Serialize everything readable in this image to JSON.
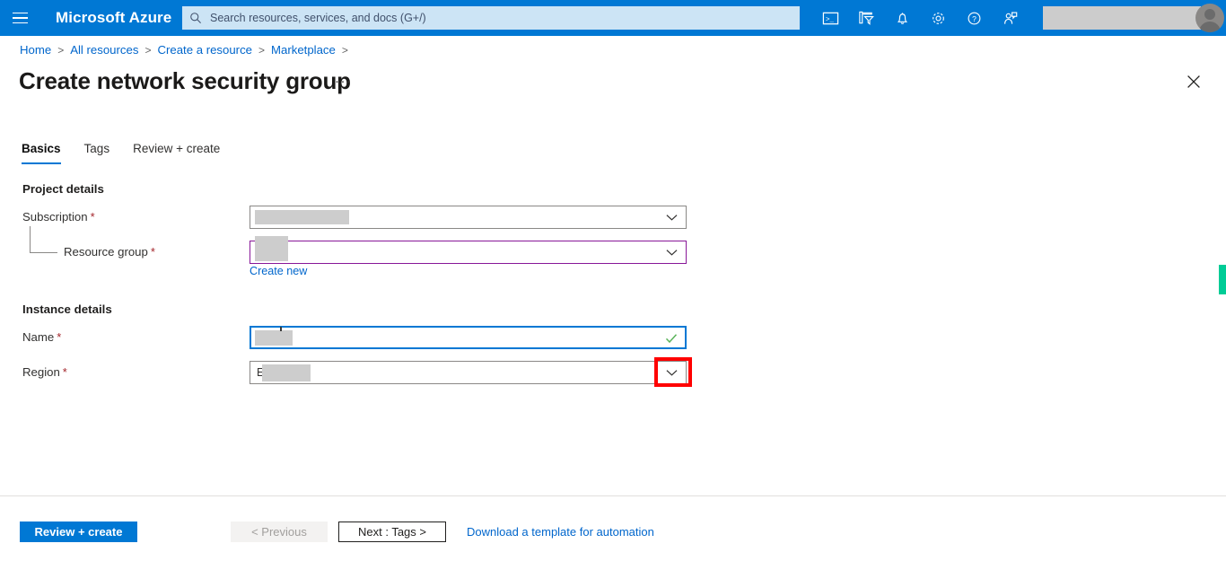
{
  "topbar": {
    "menu_icon": "hamburger-icon",
    "brand": "Microsoft Azure",
    "search_placeholder": "Search resources, services, and docs (G+/)",
    "search_value": "",
    "icons": [
      {
        "name": "cloud-shell-icon",
        "title": "Cloud Shell"
      },
      {
        "name": "directory-filter-icon",
        "title": "Directories + subscriptions"
      },
      {
        "name": "notifications-bell-icon",
        "title": "Notifications"
      },
      {
        "name": "settings-gear-icon",
        "title": "Settings"
      },
      {
        "name": "help-question-icon",
        "title": "Help"
      },
      {
        "name": "feedback-person-icon",
        "title": "Feedback"
      }
    ],
    "account_redacted": "",
    "avatar": "user-avatar"
  },
  "breadcrumb": {
    "items": [
      "Home",
      "All resources",
      "Create a resource",
      "Marketplace"
    ],
    "separator": ">",
    "trailing_separator": ">"
  },
  "page": {
    "title": "Create network security group",
    "more_actions": "···",
    "close": "✕"
  },
  "tabs": [
    {
      "label": "Basics",
      "active": true
    },
    {
      "label": "Tags",
      "active": false
    },
    {
      "label": "Review + create",
      "active": false
    }
  ],
  "form": {
    "project_details_header": "Project details",
    "instance_details_header": "Instance details",
    "subscription_label": "Subscription",
    "subscription_value": "",
    "resource_group_label": "Resource group",
    "resource_group_value": "",
    "create_new_link": "Create new",
    "name_label": "Name",
    "name_value": "",
    "region_label": "Region",
    "region_value": "E",
    "required_marker": "*"
  },
  "footer": {
    "review_create": "Review + create",
    "previous": "< Previous",
    "next": "Next : Tags >",
    "download_template": "Download a template for automation"
  },
  "colors": {
    "azure_blue": "#0078d4",
    "link_blue": "#0066cc",
    "required_red": "#a4262c",
    "highlight_red": "#ff0000",
    "resource_group_border": "#881798",
    "valid_green": "#107c10",
    "edge_marker_green": "#00cc96",
    "redaction_gray": "#cdcdcd"
  }
}
